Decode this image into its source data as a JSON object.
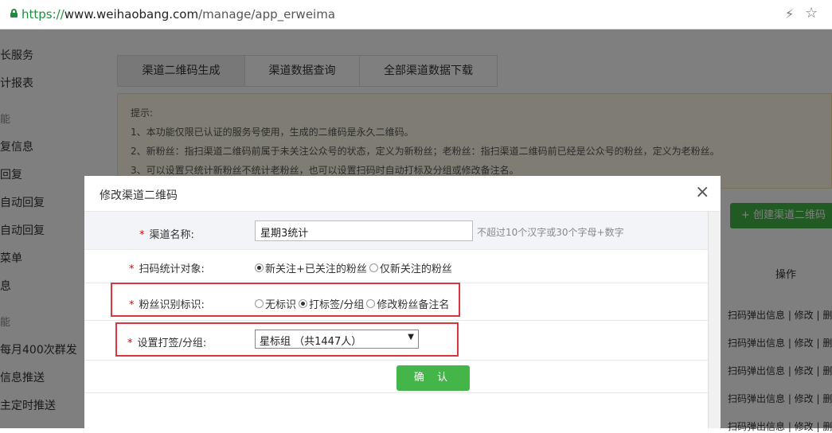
{
  "browser": {
    "url_scheme": "https://",
    "url_host": "www.weihaobang.com",
    "url_path": "/manage/app_erweima"
  },
  "sidebar": {
    "items": [
      "长服务",
      "计报表",
      "能",
      "复信息",
      "回复",
      "自动回复",
      "自动回复",
      "菜单",
      "息",
      "能",
      "每月400次群发",
      "信息推送",
      "主定时推送"
    ]
  },
  "tabs": [
    "渠道二维码生成",
    "渠道数据查询",
    "全部渠道数据下载"
  ],
  "tips": {
    "title": "提示:",
    "lines": [
      "1、本功能仅限已认证的服务号使用，生成的二维码是永久二维码。",
      "2、新粉丝：指扫渠道二维码前属于未关注公众号的状态，定义为新粉丝；老粉丝：指扫渠道二维码前已经是公众号的粉丝，定义为老粉丝。",
      "3、可以设置只统计新粉丝不统计老粉丝，也可以设置扫码时自动打标及分组或修改备注名。"
    ]
  },
  "create_button": "创建渠道二维码",
  "table": {
    "ops_header": "操作",
    "row_ops": [
      "扫码弹出信息 | 修改 | 删",
      "扫码弹出信息 | 修改 | 删",
      "扫码弹出信息 | 修改 | 删",
      "扫码弹出信息 | 修改 | 删",
      "扫码弹出信息 | 修改 | 删"
    ]
  },
  "modal": {
    "title": "修改渠道二维码",
    "close": "×",
    "name_row": {
      "label": "渠道名称:",
      "value": "星期3统计",
      "hint": "不超过10个汉字或30个字母+数字"
    },
    "target_row": {
      "label": "扫码统计对象:",
      "options": [
        "新关注+已关注的粉丝",
        "仅新关注的粉丝"
      ],
      "selected": 0
    },
    "ident_row": {
      "label": "粉丝识别标识:",
      "options": [
        "无标识",
        "打标签/分组",
        "修改粉丝备注名"
      ],
      "selected": 1
    },
    "group_row": {
      "label": "设置打签/分组:",
      "selected_value": "星标组 （共1447人）"
    },
    "confirm_label": "确 认"
  },
  "colors": {
    "accent_green": "#44b549",
    "highlight_red": "#d9363e",
    "required_red": "#d00"
  },
  "icons": {
    "lock": "lock-icon",
    "bolt": "lightning-icon",
    "star": "star-icon",
    "dropdown": "caret-down-icon"
  }
}
